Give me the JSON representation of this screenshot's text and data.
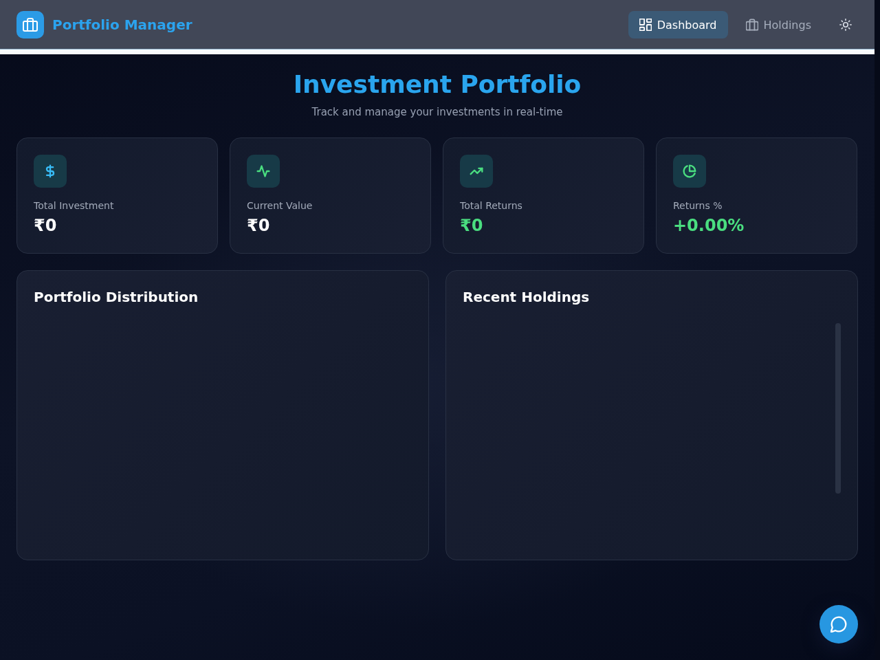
{
  "header": {
    "title": "Portfolio Manager",
    "nav": [
      {
        "label": "Dashboard",
        "selected": true
      },
      {
        "label": "Holdings",
        "selected": false
      }
    ]
  },
  "page": {
    "title": "Investment Portfolio",
    "subtitle": "Track and manage your investments in real-time"
  },
  "stat_cards": [
    {
      "label": "Total Investment",
      "value": "₹0",
      "color": "#38bdf8",
      "kind": "amount"
    },
    {
      "label": "Current Value",
      "value": "₹0",
      "color": "#4ade80",
      "kind": "amount"
    },
    {
      "label": "Total Returns",
      "value": "₹0",
      "color": "#4ade80",
      "kind": "gain"
    },
    {
      "label": "Returns %",
      "value": "+0.00%",
      "color": "#4ade80",
      "kind": "gain"
    }
  ],
  "panels": [
    {
      "title": "Portfolio Distribution",
      "kind": "chart"
    },
    {
      "title": "Recent Holdings",
      "kind": "list"
    }
  ]
}
